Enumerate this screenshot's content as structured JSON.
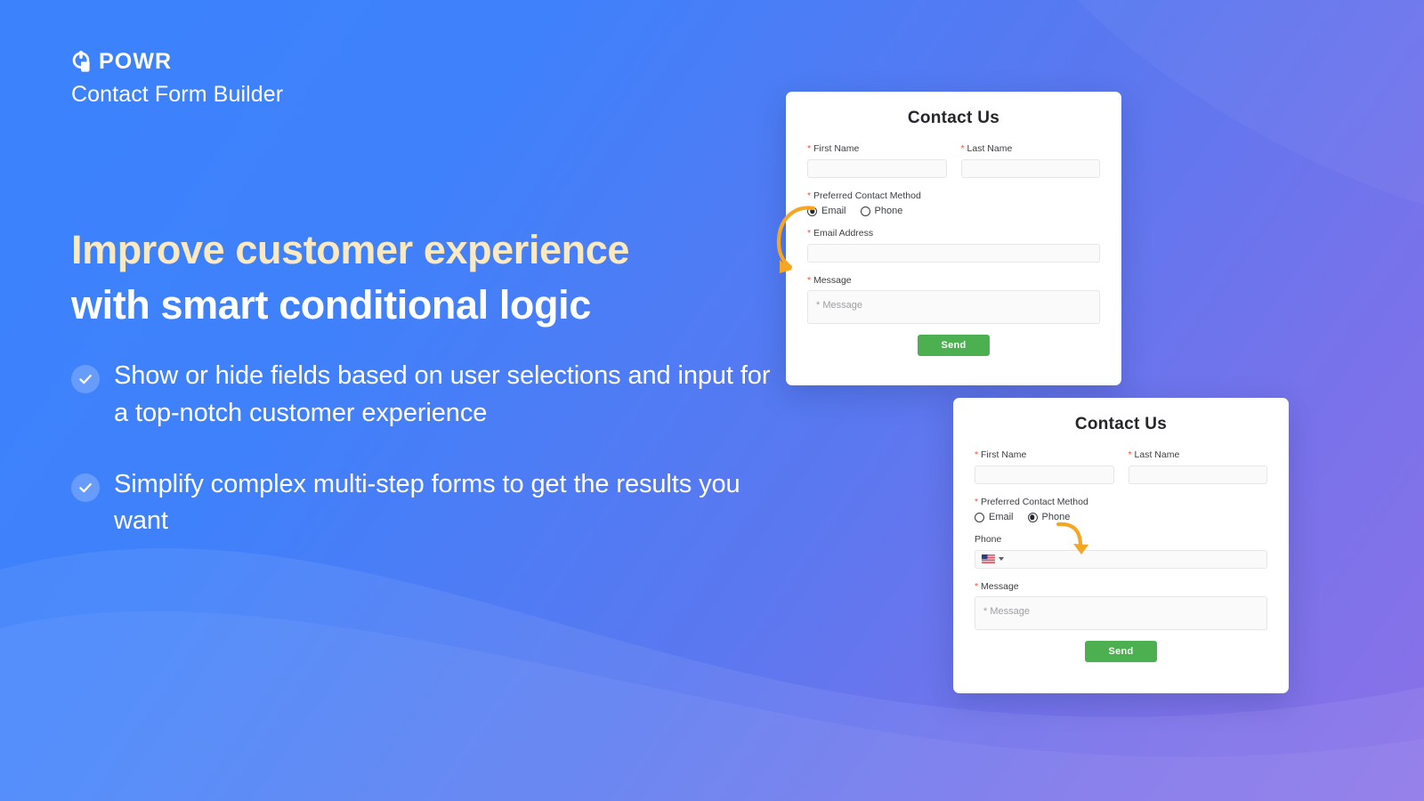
{
  "brand": {
    "logo_icon": "powr-power-plug-icon",
    "name": "POWR",
    "product": "Contact Form Builder"
  },
  "headline": {
    "line1": "Improve customer experience",
    "line2": "with smart conditional logic",
    "line1_color": "#fce9c0",
    "line2_color": "#ffffff"
  },
  "bullets": [
    {
      "icon": "check-circle-icon",
      "text": "Show or hide fields based on user selections and input for a top-notch customer experience"
    },
    {
      "icon": "check-circle-icon",
      "text": "Simplify complex multi-step forms to get the results you want"
    }
  ],
  "forms": [
    {
      "id": "email-variant",
      "title": "Contact Us",
      "first_name": {
        "label": "First Name",
        "required_mark": "*",
        "value": "",
        "placeholder": ""
      },
      "last_name": {
        "label": "Last Name",
        "required_mark": "*",
        "value": "",
        "placeholder": ""
      },
      "contact_method": {
        "label": "Preferred Contact Method",
        "required_mark": "*",
        "options": [
          "Email",
          "Phone"
        ],
        "selected": "Email"
      },
      "conditional_field": {
        "type": "email",
        "label": "Email Address",
        "required_mark": "*",
        "value": "",
        "placeholder": ""
      },
      "message": {
        "label": "Message",
        "required_mark": "*",
        "value": "",
        "placeholder": "* Message"
      },
      "submit_label": "Send",
      "annotation_arrow": "arrow-email-to-email-address"
    },
    {
      "id": "phone-variant",
      "title": "Contact Us",
      "first_name": {
        "label": "First Name",
        "required_mark": "*",
        "value": "",
        "placeholder": ""
      },
      "last_name": {
        "label": "Last Name",
        "required_mark": "*",
        "value": "",
        "placeholder": ""
      },
      "contact_method": {
        "label": "Preferred Contact Method",
        "required_mark": "*",
        "options": [
          "Email",
          "Phone"
        ],
        "selected": "Phone"
      },
      "conditional_field": {
        "type": "phone",
        "label": "Phone",
        "required_mark": "",
        "value": "",
        "placeholder": "",
        "country_flag_icon": "us-flag-icon",
        "country_dropdown_icon": "chevron-down-icon"
      },
      "message": {
        "label": "Message",
        "required_mark": "*",
        "value": "",
        "placeholder": "* Message"
      },
      "submit_label": "Send",
      "annotation_arrow": "arrow-phone-to-phone-field"
    }
  ],
  "colors": {
    "bg_start": "#3b82fc",
    "bg_end": "#8a71e8",
    "accent_cream": "#fce9c0",
    "submit_green": "#4cb050",
    "required_red": "#f0503a",
    "arrow_orange": "#f5a623"
  }
}
